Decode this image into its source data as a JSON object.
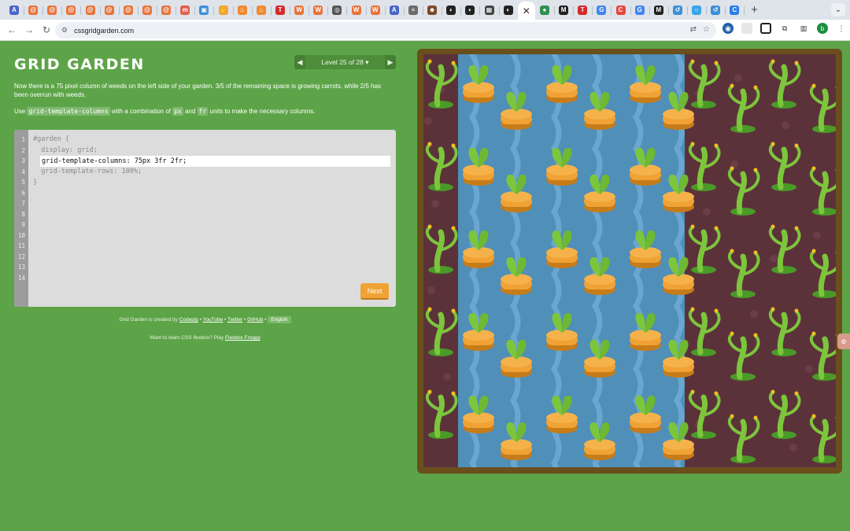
{
  "browser": {
    "tabs": [
      {
        "icon": "A",
        "color": "#4a66c9"
      },
      {
        "icon": "@",
        "color": "#e8743b"
      },
      {
        "icon": "@",
        "color": "#e8743b"
      },
      {
        "icon": "@",
        "color": "#e8743b"
      },
      {
        "icon": "@",
        "color": "#e8743b"
      },
      {
        "icon": "@",
        "color": "#e8743b"
      },
      {
        "icon": "@",
        "color": "#e8743b"
      },
      {
        "icon": "@",
        "color": "#e8743b"
      },
      {
        "icon": "@",
        "color": "#e8743b"
      },
      {
        "icon": "m",
        "color": "#e06050"
      },
      {
        "icon": "▣",
        "color": "#3d8fd8"
      },
      {
        "icon": "✋",
        "color": "#f2a33b"
      },
      {
        "icon": "♨",
        "color": "#f08a30"
      },
      {
        "icon": "♨",
        "color": "#f08a30"
      },
      {
        "icon": "T",
        "color": "#d22b2b"
      },
      {
        "icon": "W",
        "color": "#e8743b"
      },
      {
        "icon": "W",
        "color": "#e8743b"
      },
      {
        "icon": "◎",
        "color": "#555555"
      },
      {
        "icon": "W",
        "color": "#e8743b"
      },
      {
        "icon": "W",
        "color": "#e8743b"
      },
      {
        "icon": "A",
        "color": "#4a66c9"
      },
      {
        "icon": "≡",
        "color": "#6b6b6b"
      },
      {
        "icon": "☻",
        "color": "#7a4a2a"
      },
      {
        "icon": "◐",
        "color": "#222222"
      },
      {
        "icon": "◐",
        "color": "#222222"
      },
      {
        "icon": "▦",
        "color": "#444444"
      },
      {
        "icon": "◐",
        "color": "#222222"
      },
      {
        "icon": "✕",
        "color": "#ffffff",
        "active": true
      },
      {
        "icon": "●",
        "color": "#2f8f50"
      },
      {
        "icon": "M",
        "color": "#222222"
      },
      {
        "icon": "T",
        "color": "#d22b2b"
      },
      {
        "icon": "G",
        "color": "#4285f4"
      },
      {
        "icon": "C",
        "color": "#e8453c"
      },
      {
        "icon": "G",
        "color": "#4285f4"
      },
      {
        "icon": "M",
        "color": "#222222"
      },
      {
        "icon": "↺",
        "color": "#3d8fd8"
      },
      {
        "icon": "○",
        "color": "#3aa5e8"
      },
      {
        "icon": "↺",
        "color": "#3d8fd8"
      },
      {
        "icon": "C",
        "color": "#2a7ee8"
      }
    ],
    "new_tab": "+",
    "tab_menu": "⌄",
    "url": "cssgridgarden.com"
  },
  "page": {
    "logo": "Grid Garden",
    "level_label": "Level 25 of 28 ▾",
    "instructions": "Now there is a 75 pixel column of weeds on the left side of your garden. 3/5 of the remaining space is growing carrots, while 2/5 has been overrun with weeds.",
    "instr2_pre": "Use ",
    "instr2_code1": "grid-template-columns",
    "instr2_mid": " with a combination of ",
    "instr2_code2": "px",
    "instr2_and": " and ",
    "instr2_code3": "fr",
    "instr2_post": " units to make the necessary columns.",
    "line_numbers": [
      "1",
      "2",
      "3",
      "4",
      "5",
      "6",
      "7",
      "8",
      "9",
      "10",
      "11",
      "12",
      "13",
      "14"
    ],
    "code_before": [
      "#garden {",
      "  display: grid;"
    ],
    "code_input": "grid-template-columns: 75px 3fr 2fr;",
    "code_after": [
      "  grid-template-rows: 100%;",
      "}"
    ],
    "next_label": "Next",
    "credits_pre": "Grid Garden is created by ",
    "credits_links": [
      "Codepip",
      "YouTube",
      "Twitter",
      "GitHub"
    ],
    "language": "English",
    "promo_pre": "Want to learn CSS flexbox? Play ",
    "promo_link": "Flexbox Froggy"
  },
  "garden": {
    "columns": [
      "weeds",
      "carrots",
      "weeds"
    ],
    "colors": {
      "soil": "#5c323a",
      "water": "#4f8fb8",
      "frame": "#6a4f1c",
      "carrot": "#f0a234",
      "leaf": "#7cc63c",
      "weed": "#7cc63c"
    }
  }
}
